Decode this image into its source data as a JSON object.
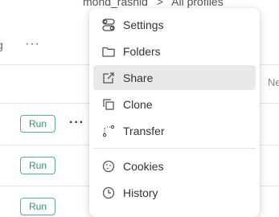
{
  "breadcrumb": {
    "left": "mohd_rashid",
    "sep": ">",
    "right": "All profiles"
  },
  "table": {
    "left_fragment": "g",
    "header_more": "···",
    "right_fragment": "Ne",
    "rows": [
      {
        "run_label": "Run"
      },
      {
        "run_label": "Run"
      },
      {
        "run_label": "Run"
      }
    ],
    "row_more": "···"
  },
  "menu": {
    "items": [
      {
        "label": "Settings",
        "icon": "settings-toggle-icon"
      },
      {
        "label": "Folders",
        "icon": "folder-icon"
      },
      {
        "label": "Share",
        "icon": "share-icon",
        "highlighted": true
      },
      {
        "label": "Clone",
        "icon": "clone-icon"
      },
      {
        "label": "Transfer",
        "icon": "transfer-icon"
      },
      {
        "label": "Cookies",
        "icon": "cookie-icon"
      },
      {
        "label": "History",
        "icon": "history-icon"
      }
    ]
  },
  "colors": {
    "run_border": "#52b788",
    "run_text": "#2b9a5e",
    "menu_highlight": "#e9e9e9"
  }
}
